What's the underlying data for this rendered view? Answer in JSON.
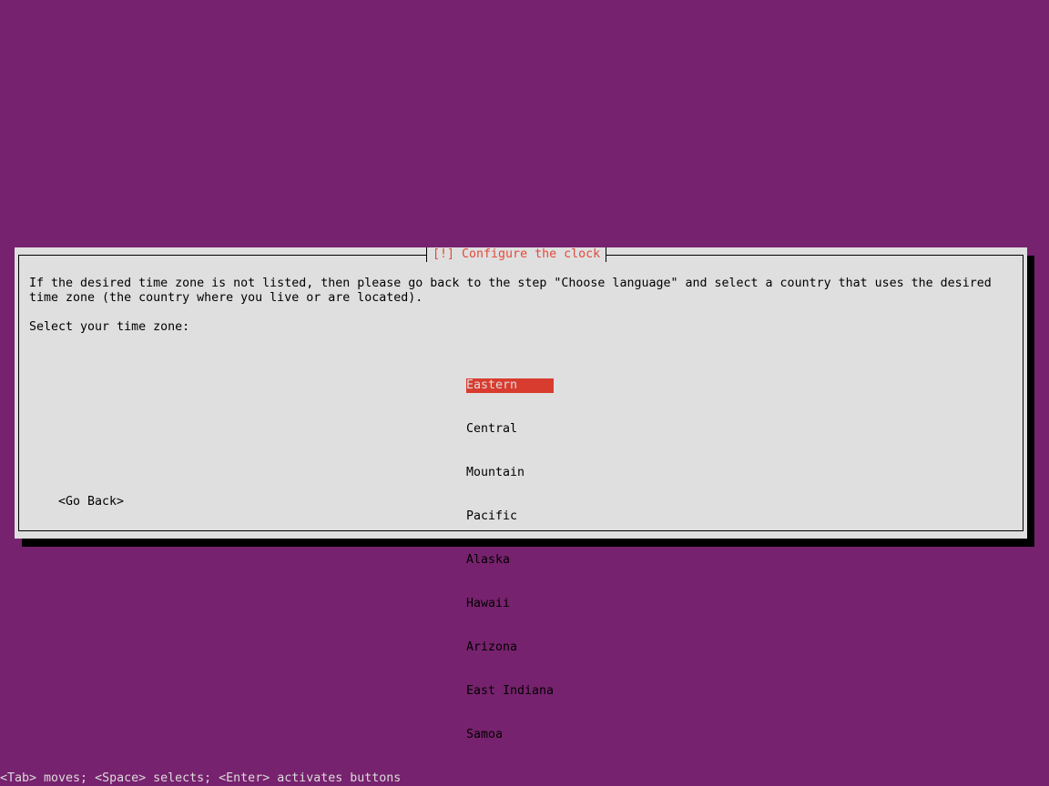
{
  "colors": {
    "background": "#77226e",
    "dialog_bg": "#dfdfdf",
    "title_color": "#e24a3a",
    "selected_bg": "#d83c2f"
  },
  "dialog": {
    "title": "[!] Configure the clock",
    "message_line1": "If the desired time zone is not listed, then please go back to the step \"Choose language\" and select a country that uses the desired",
    "message_line2": "time zone (the country where you live or are located).",
    "prompt": "Select your time zone:",
    "timezones": [
      {
        "label": "Eastern",
        "selected": true
      },
      {
        "label": "Central",
        "selected": false
      },
      {
        "label": "Mountain",
        "selected": false
      },
      {
        "label": "Pacific",
        "selected": false
      },
      {
        "label": "Alaska",
        "selected": false
      },
      {
        "label": "Hawaii",
        "selected": false
      },
      {
        "label": "Arizona",
        "selected": false
      },
      {
        "label": "East Indiana",
        "selected": false
      },
      {
        "label": "Samoa",
        "selected": false
      }
    ],
    "go_back_label": "<Go Back>"
  },
  "status_bar": {
    "text": "<Tab> moves; <Space> selects; <Enter> activates buttons"
  }
}
